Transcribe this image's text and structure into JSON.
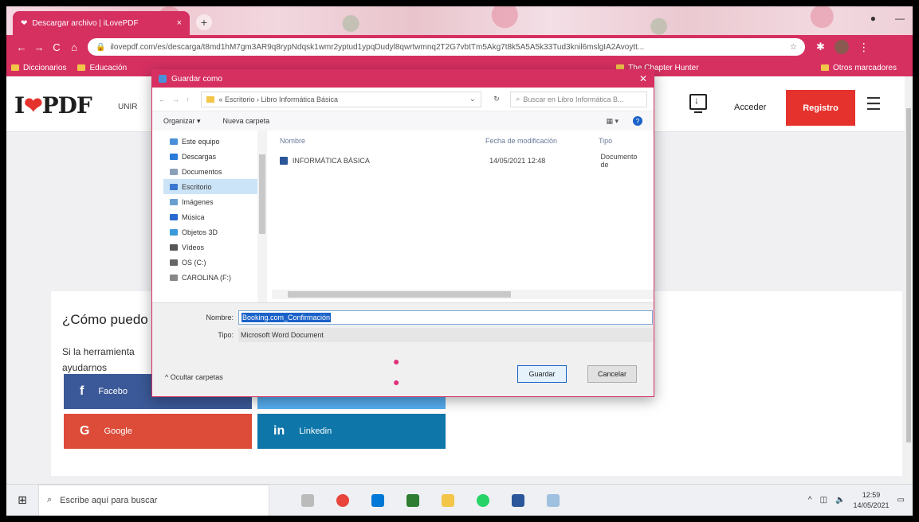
{
  "browser": {
    "tab_title": "Descargar archivo | iLovePDF",
    "tab_close": "×",
    "new_tab": "+",
    "url": "ilovepdf.com/es/descarga/t8md1hM7gm3AR9q8rypNdqsk1wmr2yptud1ypqDudyl8qwrtwmnq2T2G7vbtTm5Akg7t8k5A5A5k33Tud3knil6mslgIA2Avoytt...",
    "bookmarks": [
      "Diccionarios",
      "Educación",
      "The Chapter Hunter",
      "Otros marcadores"
    ]
  },
  "site": {
    "logo_text": "PDF",
    "logo_prefix": "I",
    "unir_text": "UNIR",
    "acceder": "Acceder",
    "registro": "Registro",
    "help_title": "¿Cómo puedo",
    "help_text": "Si la herramienta ayudarnos",
    "social": {
      "facebook": "Facebo",
      "google": "Google",
      "linkedin": "Linkedin"
    }
  },
  "dialog": {
    "title": "Guardar como",
    "path": "« Escritorio › Libro Informática Básica",
    "search_placeholder": "Buscar en Libro Informática B...",
    "organize": "Organizar ▾",
    "new_folder": "Nueva carpeta",
    "nav_items": [
      {
        "label": "Este equipo",
        "color": "#4a90d9"
      },
      {
        "label": "Descargas",
        "color": "#2a7ad9"
      },
      {
        "label": "Documentos",
        "color": "#8aa0b8"
      },
      {
        "label": "Escritorio",
        "color": "#3a78d0",
        "selected": true
      },
      {
        "label": "Imágenes",
        "color": "#6aa0d0"
      },
      {
        "label": "Música",
        "color": "#2a6ad0"
      },
      {
        "label": "Objetos 3D",
        "color": "#3a9ad9"
      },
      {
        "label": "Vídeos",
        "color": "#555"
      },
      {
        "label": "OS (C:)",
        "color": "#666"
      },
      {
        "label": "CAROLINA (F:)",
        "color": "#888"
      }
    ],
    "columns": {
      "name": "Nombre",
      "date": "Fecha de modificación",
      "type": "Tipo"
    },
    "files": [
      {
        "name": "INFORMÁTICA BÁSICA",
        "date": "14/05/2021 12:48",
        "type": "Documento de"
      }
    ],
    "filename_label": "Nombre:",
    "filename_value": "Booking.com_Confirmación",
    "filetype_label": "Tipo:",
    "filetype_value": "Microsoft Word Document",
    "hide_folders": "Ocultar carpetas",
    "save": "Guardar",
    "cancel": "Cancelar"
  },
  "taskbar": {
    "search_placeholder": "Escribe aquí para buscar",
    "time": "12:59",
    "date": "14/05/2021"
  }
}
